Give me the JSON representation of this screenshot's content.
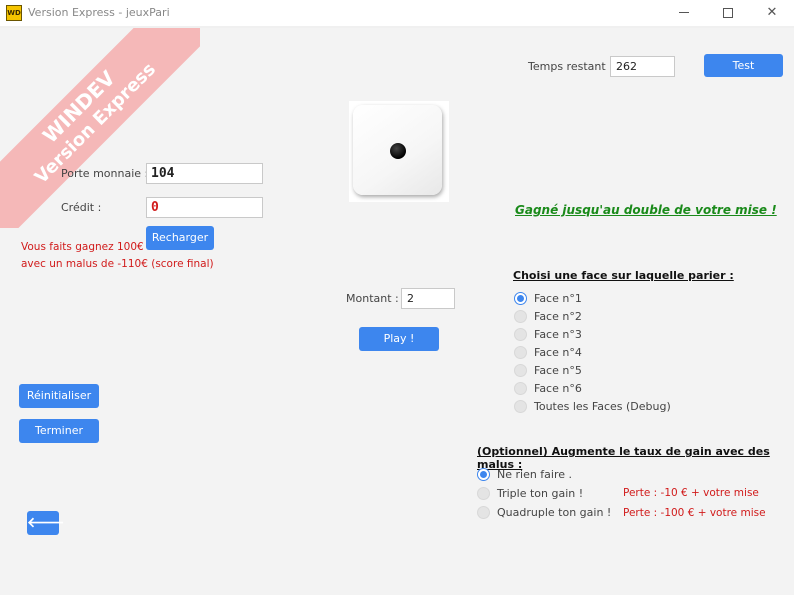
{
  "window": {
    "logo_text": "WD",
    "title": "Version Express - jeuxPari",
    "minimize": "minimize",
    "maximize": "maximize",
    "close": "✕"
  },
  "watermark": {
    "line1": "WINDEV",
    "line2": "Version Express"
  },
  "timer": {
    "label": "Temps restant :",
    "value": "262"
  },
  "test_button": "Test",
  "wallet": {
    "porte_label": "Porte monnaie :",
    "porte_value": "104",
    "credit_label": "Crédit :",
    "credit_value": "0",
    "recharger_button": "Recharger"
  },
  "result_text": {
    "line1": "Vous faits gagnez 100€",
    "line2": "avec un malus de -110€ (score final)"
  },
  "die": {
    "value": 1,
    "icon": "die-face-1-icon"
  },
  "gagne_text": "Gagné jusqu'au double de votre mise !",
  "bet": {
    "montant_label": "Montant :",
    "montant_value": "2",
    "play_button": "Play !"
  },
  "faces": {
    "title": "Choisi une face sur laquelle parier :",
    "selected_index": 0,
    "options": [
      "Face n°1",
      "Face n°2",
      "Face n°3",
      "Face n°4",
      "Face n°5",
      "Face n°6",
      "Toutes les Faces (Debug)"
    ]
  },
  "malus": {
    "title": "(Optionnel) Augmente le taux de gain avec des malus :",
    "selected_index": 0,
    "options": [
      {
        "label": "Ne rien faire .",
        "perte": ""
      },
      {
        "label": "Triple ton gain !",
        "perte": "Perte : -10 € + votre mise"
      },
      {
        "label": "Quadruple ton gain !",
        "perte": "Perte : -100 € + votre mise"
      }
    ]
  },
  "buttons": {
    "reinitialiser": "Réinitialiser",
    "terminer": "Terminer",
    "back_icon": "arrow-left-icon"
  },
  "colors": {
    "accent": "#3d86ee",
    "error_red": "#d11b1b",
    "gain_green": "#1a8a1a",
    "watermark_pink": "#f5b8b8"
  }
}
